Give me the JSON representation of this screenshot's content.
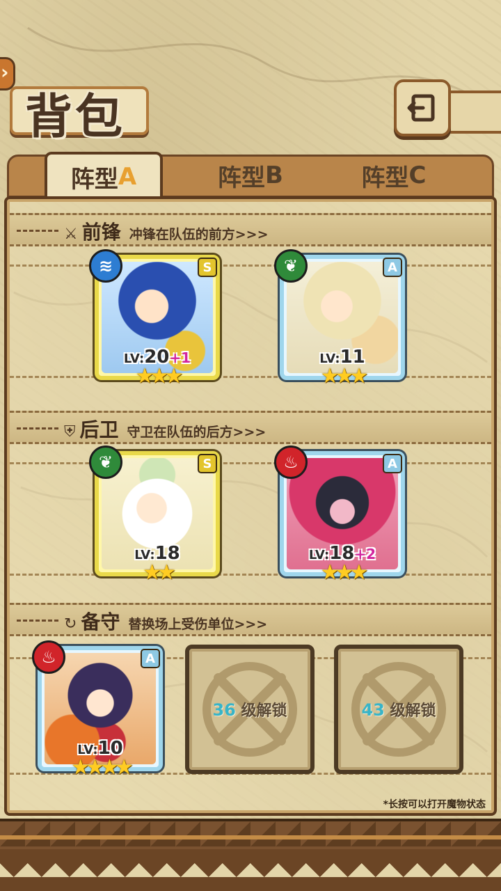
{
  "header": {
    "title": "背包"
  },
  "tabs": [
    {
      "label": "阵型",
      "letter": "A",
      "active": true
    },
    {
      "label": "阵型",
      "letter": "B",
      "active": false
    },
    {
      "label": "阵型",
      "letter": "C",
      "active": false
    }
  ],
  "sections": {
    "front": {
      "title": "前锋",
      "desc": "冲锋在队伍的前方>>>",
      "icon": "sword-icon"
    },
    "back": {
      "title": "后卫",
      "desc": "守卫在队伍的后方>>>",
      "icon": "shield-icon"
    },
    "reserve": {
      "title": "备守",
      "desc": "替换场上受伤单位>>>",
      "icon": "swap-icon"
    }
  },
  "front_units": [
    {
      "rank": "S",
      "element": "water",
      "lv_prefix": "LV:",
      "level": "20",
      "bonus": "+1",
      "stars": "★★★"
    },
    {
      "rank": "A",
      "element": "grass",
      "lv_prefix": "LV:",
      "level": "11",
      "bonus": "",
      "stars": "★★★"
    }
  ],
  "back_units": [
    {
      "rank": "S",
      "element": "grass",
      "lv_prefix": "LV:",
      "level": "18",
      "bonus": "",
      "stars": "★★"
    },
    {
      "rank": "A",
      "element": "fire",
      "lv_prefix": "LV:",
      "level": "18",
      "bonus": "+2",
      "stars": "★★★"
    }
  ],
  "reserve_units": [
    {
      "rank": "A",
      "element": "fire",
      "lv_prefix": "LV:",
      "level": "10",
      "bonus": "",
      "stars": "★★★★"
    }
  ],
  "locked_slots": [
    {
      "level": "36",
      "label": " 级解锁"
    },
    {
      "level": "43",
      "label": " 级解锁"
    }
  ],
  "footnote": "*长按可以打开魔物状态",
  "colors": {
    "gold_frame": "#e9d94a",
    "blue_frame": "#9fd6ec",
    "water": "#2d7dd2",
    "grass": "#2f8a3a",
    "fire": "#d1242a",
    "bonus": "#d2259e",
    "unlock_level": "#38b4c8"
  }
}
